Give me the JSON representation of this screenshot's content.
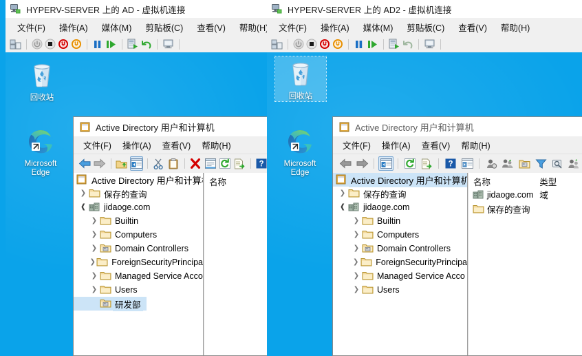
{
  "vm_window_ad": {
    "title": "HYPERV-SERVER 上的 AD - 虚拟机连接",
    "icon": "virtual-machine-icon",
    "menu": [
      {
        "label": "文件(F)"
      },
      {
        "label": "操作(A)"
      },
      {
        "label": "媒体(M)"
      },
      {
        "label": "剪贴板(C)"
      },
      {
        "label": "查看(V)"
      },
      {
        "label": "帮助(H)"
      }
    ],
    "toolbar": [
      {
        "name": "ctrl-alt-delete-icon"
      },
      {
        "name": "start-icon"
      },
      {
        "name": "turn-off-icon"
      },
      {
        "name": "shut-down-icon"
      },
      {
        "name": "save-icon"
      },
      {
        "name": "pause-icon"
      },
      {
        "name": "resume-icon"
      },
      {
        "name": "checkpoint-icon"
      },
      {
        "name": "revert-icon"
      },
      {
        "name": "enhanced-session-icon"
      }
    ],
    "desktop": {
      "background_color": "#0aa3ea",
      "icons": [
        {
          "name": "recycle-bin-icon",
          "label": "回收站",
          "selected": false
        },
        {
          "name": "microsoft-edge-icon",
          "label": "Microsoft Edge",
          "label_line1": "Microsoft",
          "label_line2": "Edge",
          "selected": false
        }
      ]
    }
  },
  "vm_window_ad2": {
    "title": "HYPERV-SERVER 上的 AD2 - 虚拟机连接",
    "icon": "virtual-machine-icon",
    "menu": [
      {
        "label": "文件(F)"
      },
      {
        "label": "操作(A)"
      },
      {
        "label": "媒体(M)"
      },
      {
        "label": "剪贴板(C)"
      },
      {
        "label": "查看(V)"
      },
      {
        "label": "帮助(H)"
      }
    ],
    "toolbar": [
      {
        "name": "ctrl-alt-delete-icon"
      },
      {
        "name": "start-icon"
      },
      {
        "name": "turn-off-icon"
      },
      {
        "name": "shut-down-icon"
      },
      {
        "name": "save-icon"
      },
      {
        "name": "pause-icon"
      },
      {
        "name": "resume-icon"
      },
      {
        "name": "checkpoint-icon"
      },
      {
        "name": "revert-icon"
      },
      {
        "name": "enhanced-session-icon"
      }
    ],
    "desktop": {
      "background_color": "#0aa3ea",
      "icons": [
        {
          "name": "recycle-bin-icon",
          "label": "回收站",
          "selected": true
        },
        {
          "name": "microsoft-edge-icon",
          "label": "Microsoft Edge",
          "label_line1": "Microsoft",
          "label_line2": "Edge",
          "selected": false
        }
      ]
    }
  },
  "aduc_ad": {
    "title": "Active Directory 用户和计算机",
    "icon": "mmc-console-icon",
    "menu": [
      {
        "label": "文件(F)"
      },
      {
        "label": "操作(A)"
      },
      {
        "label": "查看(V)"
      },
      {
        "label": "帮助(H)"
      }
    ],
    "toolbar": [
      {
        "name": "back-arrow-icon"
      },
      {
        "name": "forward-arrow-icon"
      },
      {
        "name": "up-one-level-icon"
      },
      {
        "name": "show-hide-tree-icon",
        "pressed": true
      },
      {
        "name": "cut-icon"
      },
      {
        "name": "paste-icon"
      },
      {
        "name": "delete-icon"
      },
      {
        "name": "properties-icon"
      },
      {
        "name": "refresh-icon"
      },
      {
        "name": "export-list-icon"
      },
      {
        "name": "help-icon"
      }
    ],
    "tree": [
      {
        "label": "Active Directory 用户和计算机",
        "icon": "mmc-console-icon",
        "level": 0,
        "chevron": "none",
        "selected": false
      },
      {
        "label": "保存的查询",
        "icon": "saved-queries-folder-icon",
        "level": 1,
        "chevron": "collapsed",
        "selected": false
      },
      {
        "label": "jidaoge.com",
        "icon": "domain-icon",
        "level": 1,
        "chevron": "expanded",
        "selected": false
      },
      {
        "label": "Builtin",
        "icon": "folder-icon",
        "level": 2,
        "chevron": "collapsed",
        "selected": false
      },
      {
        "label": "Computers",
        "icon": "folder-icon",
        "level": 2,
        "chevron": "collapsed",
        "selected": false
      },
      {
        "label": "Domain Controllers",
        "icon": "ou-icon",
        "level": 2,
        "chevron": "collapsed",
        "selected": false
      },
      {
        "label": "ForeignSecurityPrincipa",
        "icon": "folder-icon",
        "level": 2,
        "chevron": "collapsed",
        "selected": false
      },
      {
        "label": "Managed Service Acco",
        "icon": "folder-icon",
        "level": 2,
        "chevron": "collapsed",
        "selected": false
      },
      {
        "label": "Users",
        "icon": "folder-icon",
        "level": 2,
        "chevron": "collapsed",
        "selected": false
      },
      {
        "label": "研发部",
        "icon": "ou-icon",
        "level": 2,
        "chevron": "none",
        "selected": true
      }
    ],
    "list": {
      "columns": [
        "名称"
      ],
      "rows": []
    }
  },
  "aduc_ad2": {
    "title": "Active Directory 用户和计算机",
    "icon": "mmc-console-icon",
    "menu": [
      {
        "label": "文件(F)"
      },
      {
        "label": "操作(A)"
      },
      {
        "label": "查看(V)"
      },
      {
        "label": "帮助(H)"
      }
    ],
    "toolbar": [
      {
        "name": "back-arrow-icon"
      },
      {
        "name": "forward-arrow-icon"
      },
      {
        "name": "show-hide-tree-icon",
        "pressed": true
      },
      {
        "name": "refresh-icon"
      },
      {
        "name": "export-list-icon"
      },
      {
        "name": "help-icon"
      },
      {
        "name": "show-console-tree-icon"
      },
      {
        "name": "find-user-icon"
      },
      {
        "name": "new-user-icon"
      },
      {
        "name": "new-group-icon"
      },
      {
        "name": "new-ou-icon"
      },
      {
        "name": "filter-icon"
      },
      {
        "name": "query-icon"
      },
      {
        "name": "new-contact-icon"
      }
    ],
    "tree": [
      {
        "label": "Active Directory 用户和计算机",
        "icon": "mmc-console-icon",
        "level": 0,
        "chevron": "none",
        "selected": true
      },
      {
        "label": "保存的查询",
        "icon": "saved-queries-folder-icon",
        "level": 1,
        "chevron": "collapsed",
        "selected": false
      },
      {
        "label": "jidaoge.com",
        "icon": "domain-icon",
        "level": 1,
        "chevron": "expanded",
        "selected": false
      },
      {
        "label": "Builtin",
        "icon": "folder-icon",
        "level": 2,
        "chevron": "collapsed",
        "selected": false
      },
      {
        "label": "Computers",
        "icon": "folder-icon",
        "level": 2,
        "chevron": "collapsed",
        "selected": false
      },
      {
        "label": "Domain Controllers",
        "icon": "ou-icon",
        "level": 2,
        "chevron": "collapsed",
        "selected": false
      },
      {
        "label": "ForeignSecurityPrincipa",
        "icon": "folder-icon",
        "level": 2,
        "chevron": "collapsed",
        "selected": false
      },
      {
        "label": "Managed Service Acco",
        "icon": "folder-icon",
        "level": 2,
        "chevron": "collapsed",
        "selected": false
      },
      {
        "label": "Users",
        "icon": "folder-icon",
        "level": 2,
        "chevron": "collapsed",
        "selected": false
      }
    ],
    "list": {
      "columns": [
        "名称",
        "类型"
      ],
      "rows": [
        {
          "name": "jidaoge.com",
          "type": "域",
          "icon": "domain-icon"
        },
        {
          "name": "保存的查询",
          "type": "",
          "icon": "saved-queries-folder-icon"
        }
      ]
    }
  },
  "colors": {
    "desktop_blue": "#0aa3ea",
    "window_chrome": "#f0f0f0",
    "titlebar": "#ffffff",
    "selection_blue": "#cce4f7",
    "accent_red": "#d40000",
    "accent_orange": "#e89000",
    "accent_green": "#2fa82f"
  }
}
